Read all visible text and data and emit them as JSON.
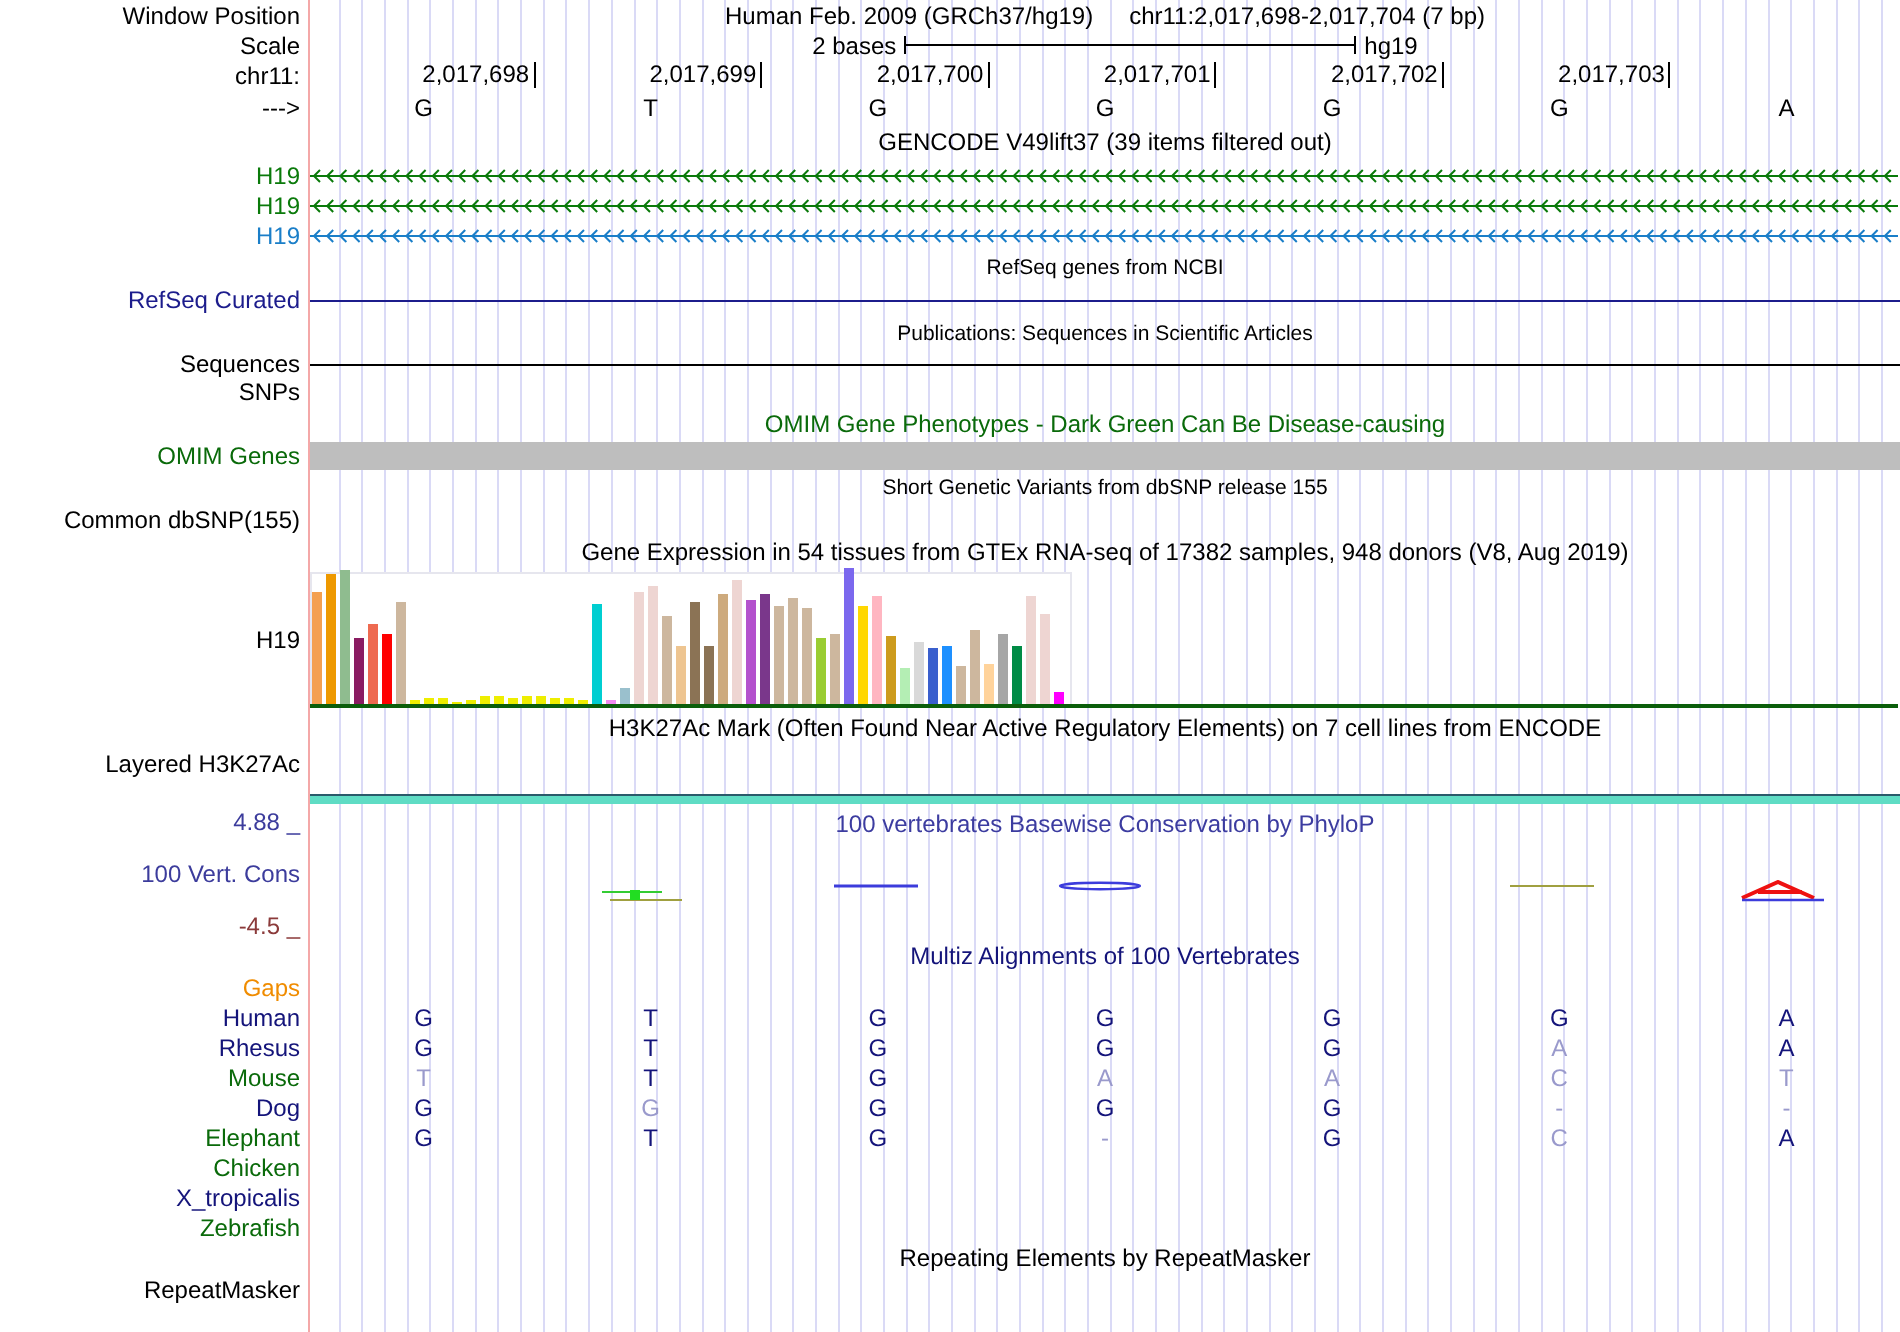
{
  "header": {
    "position_label": "Window Position",
    "assembly_title": "Human Feb. 2009 (GRCh37/hg19)",
    "region": "chr11:2,017,698-2,017,704 (7 bp)",
    "scale_label": "Scale",
    "scale_text": "2 bases",
    "scale_assembly": "hg19",
    "chrom_label": "chr11:",
    "positions": [
      "2,017,698",
      "2,017,699",
      "2,017,700",
      "2,017,701",
      "2,017,702",
      "2,017,703"
    ],
    "strand_label": "--->",
    "bases": [
      "G",
      "T",
      "G",
      "G",
      "G",
      "G",
      "A"
    ]
  },
  "tracks": [
    {
      "kind": "gencode",
      "title": "GENCODE V49lift37 (39 items filtered out)",
      "rows": [
        {
          "label": "H19",
          "color": "#0a7a0a"
        },
        {
          "label": "H19",
          "color": "#0a7a0a"
        },
        {
          "label": "H19",
          "color": "#1a7ec8"
        }
      ]
    },
    {
      "kind": "refseq",
      "title": "RefSeq genes from NCBI",
      "rows": [
        {
          "label": "RefSeq Curated",
          "color": "#1c1c8c"
        }
      ]
    },
    {
      "kind": "publications",
      "title": "Publications: Sequences in Scientific Articles",
      "rows": [
        {
          "label": "Sequences",
          "color": "#000000"
        },
        {
          "label": "SNPs",
          "color": "#000000"
        }
      ]
    },
    {
      "kind": "omim",
      "title": "OMIM Gene Phenotypes - Dark Green Can Be Disease-causing",
      "rows": [
        {
          "label": "OMIM Genes",
          "color": "#0a6a0a"
        }
      ]
    },
    {
      "kind": "dbsnp",
      "title": "Short Genetic Variants from dbSNP release 155",
      "rows": [
        {
          "label": "Common dbSNP(155)",
          "color": "#000000"
        }
      ]
    },
    {
      "kind": "gtex",
      "title": "Gene Expression in 54 tissues from GTEx RNA-seq of 17382 samples, 948 donors (V8, Aug 2019)",
      "rows": [
        {
          "label": "H19",
          "color": "#000000"
        }
      ]
    },
    {
      "kind": "h3k27ac",
      "title": "H3K27Ac Mark (Often Found Near Active Regulatory Elements) on 7 cell lines from ENCODE",
      "rows": [
        {
          "label": "Layered H3K27Ac",
          "color": "#000000"
        }
      ]
    },
    {
      "kind": "phylop",
      "title": "100 vertebrates Basewise Conservation by PhyloP",
      "axis_max": "4.88 _",
      "axis_min": "-4.5 _",
      "rows": [
        {
          "label": "100 Vert. Cons",
          "color": "#3c3c9c"
        }
      ]
    },
    {
      "kind": "multiz",
      "title": "Multiz Alignments of 100 Vertebrates",
      "rows": [
        {
          "label": "Gaps",
          "color": "#f08c00",
          "bases": []
        },
        {
          "label": "Human",
          "color": "#14147a",
          "bases": [
            {
              "base": "G",
              "match": true
            },
            {
              "base": "T",
              "match": true
            },
            {
              "base": "G",
              "match": true
            },
            {
              "base": "G",
              "match": true
            },
            {
              "base": "G",
              "match": true
            },
            {
              "base": "G",
              "match": true
            },
            {
              "base": "A",
              "match": true
            }
          ]
        },
        {
          "label": "Rhesus",
          "color": "#14147a",
          "bases": [
            {
              "base": "G",
              "match": true
            },
            {
              "base": "T",
              "match": true
            },
            {
              "base": "G",
              "match": true
            },
            {
              "base": "G",
              "match": true
            },
            {
              "base": "G",
              "match": true
            },
            {
              "base": "A",
              "match": false
            },
            {
              "base": "A",
              "match": true
            }
          ]
        },
        {
          "label": "Mouse",
          "color": "#0a6a0a",
          "bases": [
            {
              "base": "T",
              "match": false
            },
            {
              "base": "T",
              "match": true
            },
            {
              "base": "G",
              "match": true
            },
            {
              "base": "A",
              "match": false
            },
            {
              "base": "A",
              "match": false
            },
            {
              "base": "C",
              "match": false
            },
            {
              "base": "T",
              "match": false
            }
          ]
        },
        {
          "label": "Dog",
          "color": "#14147a",
          "bases": [
            {
              "base": "G",
              "match": true
            },
            {
              "base": "G",
              "match": false
            },
            {
              "base": "G",
              "match": true
            },
            {
              "base": "G",
              "match": true
            },
            {
              "base": "G",
              "match": true
            },
            {
              "base": "-",
              "match": false
            },
            {
              "base": "-",
              "match": false
            }
          ]
        },
        {
          "label": "Elephant",
          "color": "#0a6a0a",
          "bases": [
            {
              "base": "G",
              "match": true
            },
            {
              "base": "T",
              "match": true
            },
            {
              "base": "G",
              "match": true
            },
            {
              "base": "-",
              "match": false
            },
            {
              "base": "G",
              "match": true
            },
            {
              "base": "C",
              "match": false
            },
            {
              "base": "A",
              "match": true
            }
          ]
        },
        {
          "label": "Chicken",
          "color": "#0a6a0a",
          "bases": []
        },
        {
          "label": "X_tropicalis",
          "color": "#14147a",
          "bases": []
        },
        {
          "label": "Zebrafish",
          "color": "#0a6a0a",
          "bases": []
        }
      ]
    },
    {
      "kind": "repeatmasker",
      "title": "Repeating Elements by RepeatMasker",
      "rows": [
        {
          "label": "RepeatMasker",
          "color": "#000000"
        }
      ]
    }
  ]
}
